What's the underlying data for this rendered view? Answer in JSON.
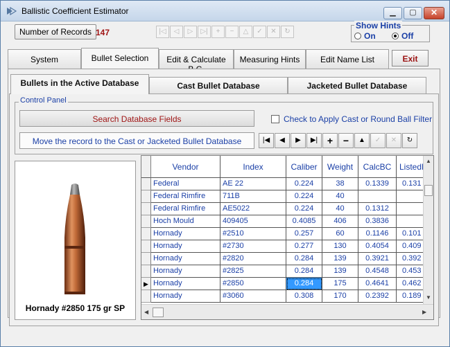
{
  "window": {
    "title": "Ballistic Coefficient Estimator"
  },
  "toolbar": {
    "records_label": "Number of Records",
    "records_count": "147"
  },
  "hints": {
    "label": "Show Hints",
    "on": "On",
    "off": "Off"
  },
  "main_tabs": [
    {
      "label": "System"
    },
    {
      "label": "Bullet Selection"
    },
    {
      "label": "Edit & Calculate B.C."
    },
    {
      "label": "Measuring Hints"
    },
    {
      "label": "Edit Name List"
    }
  ],
  "exit_label": "Exit",
  "db_tabs": [
    {
      "label": "Bullets in the Active Database"
    },
    {
      "label": "Cast Bullet Database"
    },
    {
      "label": "Jacketed Bullet Database"
    }
  ],
  "control_panel": {
    "label": "Control Panel",
    "search_label": "Search Database Fields",
    "filter_label": "Check to Apply Cast or Round Ball Filter",
    "move_label": "Move the record to the Cast or Jacketed Bullet Database"
  },
  "bullet_caption": "Hornady #2850 175 gr SP",
  "table": {
    "columns": [
      "Vendor",
      "Index",
      "Caliber",
      "Weight",
      "CalcBC",
      "ListedB"
    ],
    "rows": [
      [
        "Federal",
        "AE 22",
        "0.224",
        "38",
        "0.1339",
        "0.131"
      ],
      [
        "Federal Rimfire",
        "711B",
        "0.224",
        "40",
        "",
        ""
      ],
      [
        "Federal Rimfire",
        "AE5022",
        "0.224",
        "40",
        "0.1312",
        ""
      ],
      [
        "Hoch Mould",
        "409405",
        "0.4085",
        "406",
        "0.3836",
        ""
      ],
      [
        "Hornady",
        "#2510",
        "0.257",
        "60",
        "0.1146",
        "0.101"
      ],
      [
        "Hornady",
        "#2730",
        "0.277",
        "130",
        "0.4054",
        "0.409"
      ],
      [
        "Hornady",
        "#2820",
        "0.284",
        "139",
        "0.3921",
        "0.392"
      ],
      [
        "Hornady",
        "#2825",
        "0.284",
        "139",
        "0.4548",
        "0.453"
      ],
      [
        "Hornady",
        "#2850",
        "0.284",
        "175",
        "0.4641",
        "0.462"
      ],
      [
        "Hornady",
        "#3060",
        "0.308",
        "170",
        "0.2392",
        "0.189"
      ]
    ]
  }
}
